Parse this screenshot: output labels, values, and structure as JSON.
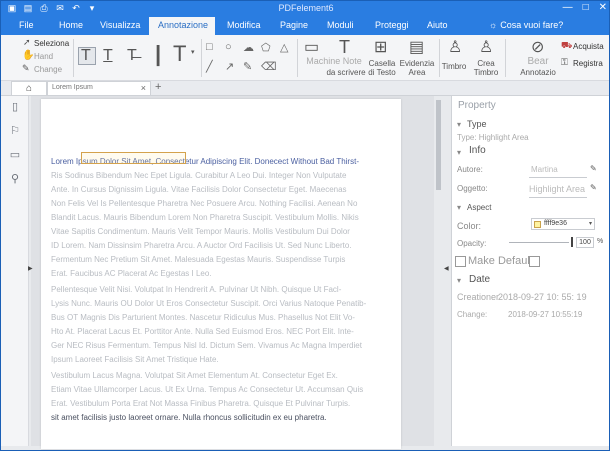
{
  "app": {
    "title": "PDFelement6",
    "window_buttons": [
      "—",
      "□",
      "✕"
    ]
  },
  "menu": {
    "items": [
      "File",
      "Home",
      "Visualizza",
      "Annotazione",
      "Modifica",
      "Pagine",
      "Moduli",
      "Proteggi",
      "Aiuto"
    ],
    "active": "Annotazione",
    "search": "Cosa vuoi fare?"
  },
  "ribbon": {
    "select_label": "Seleziona",
    "hand_label": "Hand",
    "change_label": "Change",
    "machine_note": "Machine Note",
    "machine_note_sub": "da scrivere",
    "text_box": "Casella",
    "text_box_sub": "di Testo",
    "highlight_area": "Evidenzia",
    "highlight_area_sub": "Area",
    "stamp": "Timbro",
    "create_stamp": "Crea",
    "create_stamp_sub": "Timbro",
    "annotations": "Bear",
    "annotations_sub": "Annotazio",
    "purchase": "Acquista",
    "register": "Registra"
  },
  "tabs": {
    "home_icon": "home-icon",
    "doc_tab_label": "Lorem Ipsum"
  },
  "document": {
    "lines": [
      {
        "text": "Lorem Ipsum Dolor Sit Amet, Consectetur Adipiscing Elit. Donecect Without Bad Thirst-",
        "dark": true
      },
      {
        "text": "Ris Sodinus Bibendum Nec Epet Ligula. Curabitur A Leo Dui. Integer Non Vulputate",
        "dark": false
      },
      {
        "text": "Ante. In Cursus Dignissim Ligula. Vitae Facilisis Dolor Consectetur Eget. Maecenas",
        "dark": false
      },
      {
        "text": "Non Felis Vel Is Pellentesque Pharetra Nec Posuere Arcu. Nothing Facilisi. Aenean No",
        "dark": false
      },
      {
        "text": "Blandit Lacus. Mauris Bibendum Lorem Non Pharetra Suscipit. Vestibulum Mollis. Nikis",
        "dark": false
      },
      {
        "text": "Vitae Sapitis Condimentum. Mauris Velit Tempor Mauris. Mollis Vestibulum Dui Dolor",
        "dark": false
      },
      {
        "text": "ID Lorem. Nam Dissinsim Pharetra Arcu. A Auctor Ord Facilisis Ut. Sed Nunc Liberto.",
        "dark": false
      },
      {
        "text": "Fermentum Nec Pretium Sit Amet. Malesuada Egestas Mauris. Suspendisse Turpis",
        "dark": false
      },
      {
        "text": "Erat. Faucibus AC Placerat Ac Egestas I Leo.",
        "dark": false
      },
      {
        "text": "Pellentesque Velit Nisi. Volutpat In Hendrerit A. Pulvinar Ut Nibh. Quisque Ut Facl-",
        "dark": false
      },
      {
        "text": "Lysis Nunc. Mauris OU Dolor Ut Eros Consectetur Suscipit. Orci Varius Natoque Penatib-",
        "dark": false
      },
      {
        "text": "Bus OT Magnis Dis Parturient Montes. Nascetur Ridiculus Mus. Phasellus Not Elit Vo-",
        "dark": false
      },
      {
        "text": "Hto At. Placerat Lacus Et. Porttitor Ante. Nulla Sed Euismod Eros. NEC Port Elit. Inte-",
        "dark": false
      },
      {
        "text": "Ger NEC Risus Fermentum. Tempus Nisl Id. Dictum Sem. Vivamus Ac Magna Imperdiet",
        "dark": false
      },
      {
        "text": "Ipsum Laoreet Facilisis Sit Amet Tristique Hate.",
        "dark": false
      },
      {
        "text": "Vestibulum Lacus Magna. Volutpat Sit Amet Elementum At. Consectetur Eget Ex.",
        "dark": false
      },
      {
        "text": "Etiam Vitae Ullamcorper Lacus. Ut Ex Urna. Tempus Ac Consectetur Ut. Accumsan Quis",
        "dark": false
      },
      {
        "text": "Erat. Vestibulum Porta Erat Not Massa Finibus Pharetra. Quisque Et Pulvinar Turpis.",
        "dark": false
      },
      {
        "text": "sit amet facilisis justo laoreet ornare. Nulla rhoncus sollicitudin ex eu pharetra.",
        "dark": true
      }
    ]
  },
  "panel": {
    "title": "Property",
    "type_section": "Type",
    "type_value": "Type: Highlight Area",
    "info_section": "Info",
    "author_label": "Autore:",
    "author_value": "Martina",
    "subject_label": "Oggetto:",
    "subject_value": "Highlight Area",
    "aspect_section": "Aspect",
    "color_label": "Color:",
    "color_value": "ffff9e36",
    "color_hex": "#fff3a0",
    "opacity_label": "Opacity:",
    "opacity_value": "100",
    "opacity_pct": "%",
    "opacity_fraction": 1.0,
    "make_default": "Make Default",
    "date_section": "Date",
    "created_label": "Creationer",
    "created_value": "2018-09-27 10: 55: 19",
    "changed_label": "Change:",
    "changed_value": "2018-09-27 10:55:19"
  }
}
